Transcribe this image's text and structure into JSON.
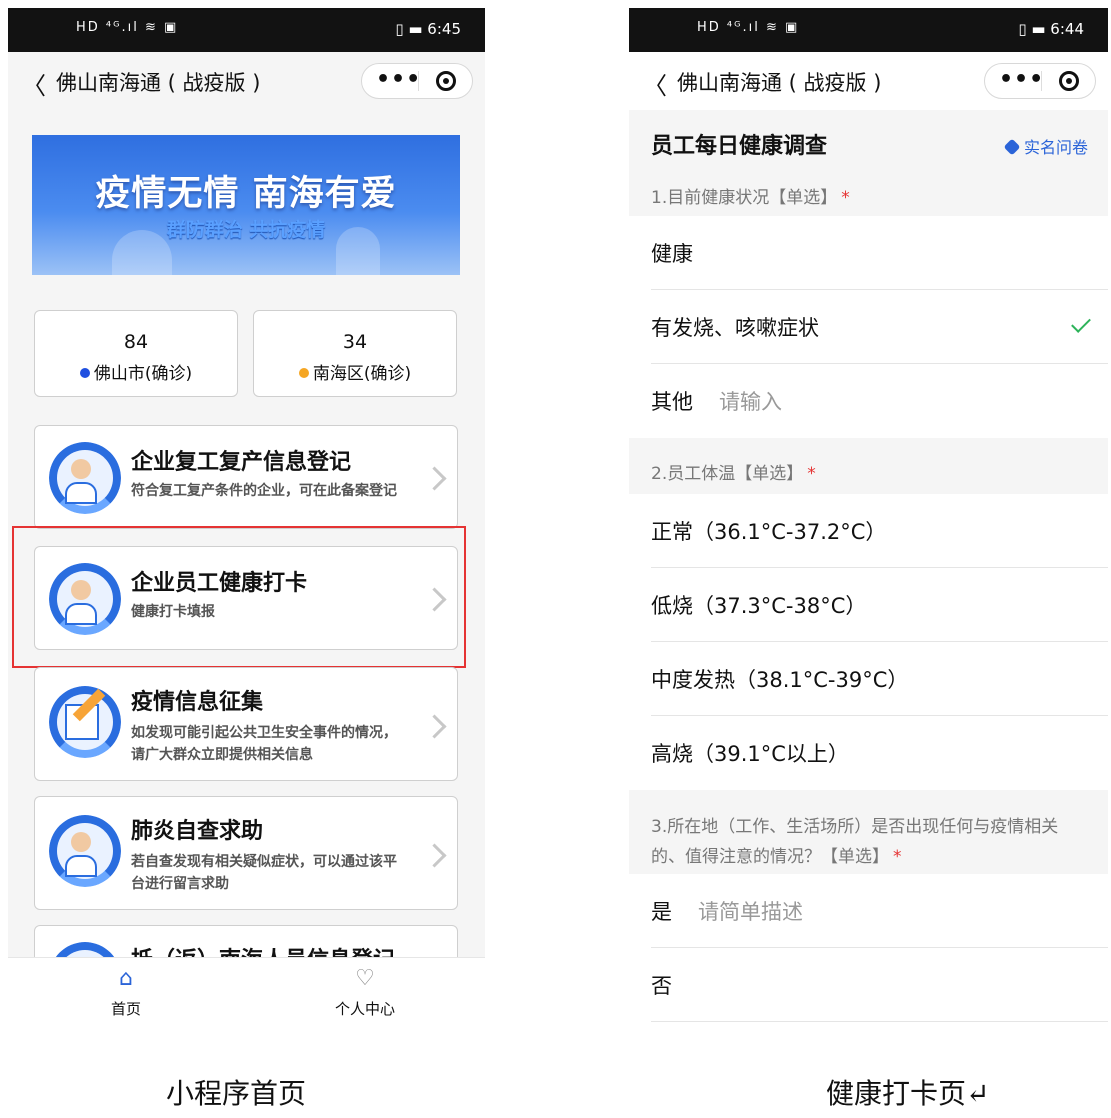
{
  "left": {
    "status": {
      "left": "HD ⁴ᴳ.ıl ≋ ▣",
      "right": "▯ ▬ 6:45"
    },
    "nav": {
      "back": "〈",
      "title": "佛山南海通 ( 战疫版 )",
      "more": "•••"
    },
    "banner": {
      "title": "疫情无情 南海有爱",
      "subtitle": "群防群治 共抗疫情"
    },
    "stats": [
      {
        "value": "84",
        "label": "佛山市(确诊)",
        "color": "#1f4fe0"
      },
      {
        "value": "34",
        "label": "南海区(确诊)",
        "color": "#f5a623"
      }
    ],
    "cards": [
      {
        "title": "企业复工复产信息登记",
        "desc": "符合复工复产条件的企业，可在此备案登记"
      },
      {
        "title": "企业员工健康打卡",
        "desc": "健康打卡填报"
      },
      {
        "title": "疫情信息征集",
        "desc": "如发现可能引起公共卫生安全事件的情况，请广大群众立即提供相关信息"
      },
      {
        "title": "肺炎自查求助",
        "desc": "若自查发现有相关疑似症状，可以通过该平台进行留言求助"
      },
      {
        "title": "抵（返）南海人员信息登记",
        "desc": ""
      }
    ],
    "tabs": [
      {
        "icon": "⌂",
        "label": "首页"
      },
      {
        "icon": "♡",
        "label": "个人中心"
      }
    ]
  },
  "right": {
    "status": {
      "left": "HD ⁴ᴳ.ıl ≋ ▣",
      "right": "▯ ▬ 6:44"
    },
    "nav": {
      "back": "〈",
      "title": "佛山南海通 ( 战疫版 )",
      "more": "•••"
    },
    "survey_title": "员工每日健康调查",
    "survey_tag": "实名问卷",
    "questions": [
      {
        "title": "1.目前健康状况【单选】",
        "options": [
          {
            "text": "健康",
            "placeholder": ""
          },
          {
            "text": "有发烧、咳嗽症状",
            "placeholder": "",
            "checked": true
          },
          {
            "text": "其他",
            "placeholder": "请输入"
          }
        ]
      },
      {
        "title": "2.员工体温【单选】",
        "options": [
          {
            "text": "正常（36.1°C-37.2°C）",
            "placeholder": ""
          },
          {
            "text": "低烧（37.3°C-38°C）",
            "placeholder": ""
          },
          {
            "text": "中度发热（38.1°C-39°C）",
            "placeholder": ""
          },
          {
            "text": "高烧（39.1°C以上）",
            "placeholder": ""
          }
        ]
      },
      {
        "title": "3.所在地（工作、生活场所）是否出现任何与疫情相关的、值得注意的情况？【单选】",
        "options": [
          {
            "text": "是",
            "placeholder": "请简单描述"
          },
          {
            "text": "否",
            "placeholder": ""
          }
        ]
      }
    ],
    "required_mark": "*"
  },
  "captions": {
    "left": "小程序首页",
    "right": "健康打卡页↵"
  }
}
